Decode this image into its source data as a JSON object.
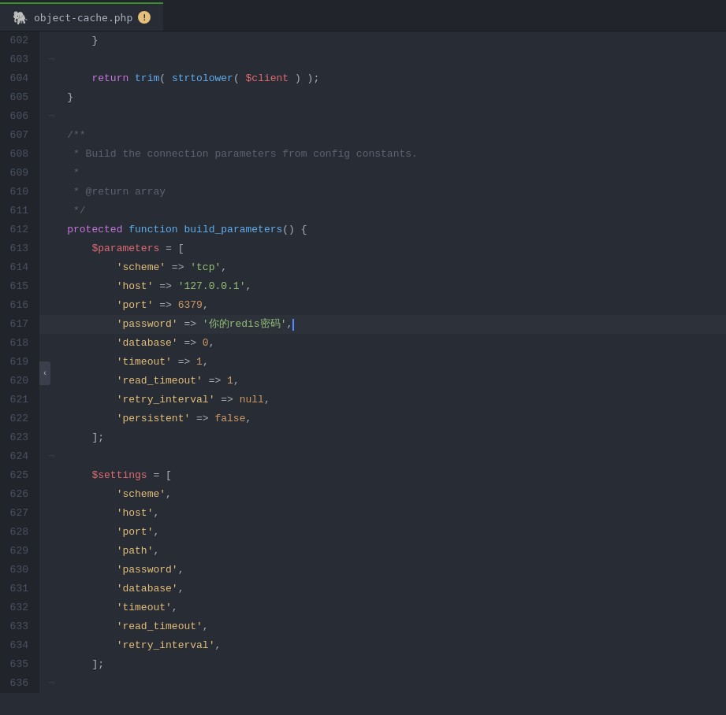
{
  "tab": {
    "icon": "🐘",
    "filename": "object-cache.php",
    "warning": "!",
    "underline_color": "#3a8f2a"
  },
  "colors": {
    "bg": "#282c34",
    "line_num_bg": "#21252b",
    "line_num_text": "#4b5263",
    "active_line": "#2c313a",
    "text_default": "#abb2bf",
    "keyword_purple": "#c678dd",
    "keyword_blue": "#61afef",
    "string_green": "#98c379",
    "number_orange": "#d19a66",
    "var_red": "#e06c75",
    "key_yellow": "#e5c07b",
    "comment_gray": "#5c6370"
  },
  "lines": [
    {
      "num": "602",
      "tokens": [
        {
          "t": "        }",
          "c": "punct"
        }
      ]
    },
    {
      "num": "603",
      "tokens": []
    },
    {
      "num": "604",
      "tokens": [
        {
          "t": "        ",
          "c": ""
        },
        {
          "t": "return",
          "c": "kw"
        },
        {
          "t": " ",
          "c": ""
        },
        {
          "t": "trim",
          "c": "fn"
        },
        {
          "t": "(",
          "c": "punct"
        },
        {
          "t": " strtolower",
          "c": "fn"
        },
        {
          "t": "(",
          "c": "punct"
        },
        {
          "t": " ",
          "c": ""
        },
        {
          "t": "$client",
          "c": "var"
        },
        {
          "t": " ",
          "c": ""
        },
        {
          "t": ")",
          "c": "punct"
        },
        {
          "t": " ",
          "c": ""
        },
        {
          "t": ");",
          "c": "punct"
        }
      ]
    },
    {
      "num": "605",
      "tokens": [
        {
          "t": "    }",
          "c": "punct"
        }
      ]
    },
    {
      "num": "606",
      "tokens": []
    },
    {
      "num": "607",
      "tokens": [
        {
          "t": "    ",
          "c": ""
        },
        {
          "t": "/**",
          "c": "comment"
        }
      ]
    },
    {
      "num": "608",
      "tokens": [
        {
          "t": "     * Build the connection parameters from config constants.",
          "c": "comment"
        }
      ]
    },
    {
      "num": "609",
      "tokens": [
        {
          "t": "     *",
          "c": "comment"
        }
      ]
    },
    {
      "num": "610",
      "tokens": [
        {
          "t": "     * @return array",
          "c": "comment"
        }
      ]
    },
    {
      "num": "611",
      "tokens": [
        {
          "t": "     */",
          "c": "comment"
        }
      ]
    },
    {
      "num": "612",
      "tokens": [
        {
          "t": "    ",
          "c": ""
        },
        {
          "t": "protected",
          "c": "kw-purple"
        },
        {
          "t": " ",
          "c": ""
        },
        {
          "t": "function",
          "c": "kw-blue"
        },
        {
          "t": " ",
          "c": ""
        },
        {
          "t": "build_parameters",
          "c": "fn"
        },
        {
          "t": "() {",
          "c": "punct"
        }
      ]
    },
    {
      "num": "613",
      "tokens": [
        {
          "t": "        ",
          "c": ""
        },
        {
          "t": "$parameters",
          "c": "var"
        },
        {
          "t": " = [",
          "c": "punct"
        }
      ]
    },
    {
      "num": "614",
      "tokens": [
        {
          "t": "            ",
          "c": ""
        },
        {
          "t": "'scheme'",
          "c": "key"
        },
        {
          "t": " => ",
          "c": "op"
        },
        {
          "t": "'tcp'",
          "c": "str"
        },
        {
          "t": ",",
          "c": "punct"
        }
      ]
    },
    {
      "num": "615",
      "tokens": [
        {
          "t": "            ",
          "c": ""
        },
        {
          "t": "'host'",
          "c": "key"
        },
        {
          "t": " => ",
          "c": "op"
        },
        {
          "t": "'127.0.0.1'",
          "c": "str"
        },
        {
          "t": ",",
          "c": "punct"
        }
      ]
    },
    {
      "num": "616",
      "tokens": [
        {
          "t": "            ",
          "c": ""
        },
        {
          "t": "'port'",
          "c": "key"
        },
        {
          "t": " => ",
          "c": "op"
        },
        {
          "t": "6379",
          "c": "num"
        },
        {
          "t": ",",
          "c": "punct"
        }
      ]
    },
    {
      "num": "617",
      "tokens": [
        {
          "t": "            ",
          "c": ""
        },
        {
          "t": "'password'",
          "c": "key"
        },
        {
          "t": " => ",
          "c": "op"
        },
        {
          "t": "'你的redis密码'",
          "c": "str"
        },
        {
          "t": ",",
          "c": "punct"
        },
        {
          "t": "|",
          "c": "cursor"
        }
      ],
      "highlight": true
    },
    {
      "num": "618",
      "tokens": [
        {
          "t": "            ",
          "c": ""
        },
        {
          "t": "'database'",
          "c": "key"
        },
        {
          "t": " => ",
          "c": "op"
        },
        {
          "t": "0",
          "c": "num"
        },
        {
          "t": ",",
          "c": "punct"
        }
      ]
    },
    {
      "num": "619",
      "tokens": [
        {
          "t": "            ",
          "c": ""
        },
        {
          "t": "'timeout'",
          "c": "key"
        },
        {
          "t": " => ",
          "c": "op"
        },
        {
          "t": "1",
          "c": "num"
        },
        {
          "t": ",",
          "c": "punct"
        }
      ]
    },
    {
      "num": "620",
      "tokens": [
        {
          "t": "            ",
          "c": ""
        },
        {
          "t": "'read_timeout'",
          "c": "key"
        },
        {
          "t": " => ",
          "c": "op"
        },
        {
          "t": "1",
          "c": "num"
        },
        {
          "t": ",",
          "c": "punct"
        }
      ]
    },
    {
      "num": "621",
      "tokens": [
        {
          "t": "            ",
          "c": ""
        },
        {
          "t": "'retry_interval'",
          "c": "key"
        },
        {
          "t": " => ",
          "c": "op"
        },
        {
          "t": "null",
          "c": "kw-null"
        },
        {
          "t": ",",
          "c": "punct"
        }
      ]
    },
    {
      "num": "622",
      "tokens": [
        {
          "t": "            ",
          "c": ""
        },
        {
          "t": "'persistent'",
          "c": "key"
        },
        {
          "t": " => ",
          "c": "op"
        },
        {
          "t": "false",
          "c": "kw-null"
        },
        {
          "t": ",",
          "c": "punct"
        }
      ]
    },
    {
      "num": "623",
      "tokens": [
        {
          "t": "        ];",
          "c": "punct"
        }
      ]
    },
    {
      "num": "624",
      "tokens": []
    },
    {
      "num": "625",
      "tokens": [
        {
          "t": "        ",
          "c": ""
        },
        {
          "t": "$settings",
          "c": "var"
        },
        {
          "t": " = [",
          "c": "punct"
        }
      ]
    },
    {
      "num": "626",
      "tokens": [
        {
          "t": "            ",
          "c": ""
        },
        {
          "t": "'scheme'",
          "c": "key"
        },
        {
          "t": ",",
          "c": "punct"
        }
      ]
    },
    {
      "num": "627",
      "tokens": [
        {
          "t": "            ",
          "c": ""
        },
        {
          "t": "'host'",
          "c": "key"
        },
        {
          "t": ",",
          "c": "punct"
        }
      ]
    },
    {
      "num": "628",
      "tokens": [
        {
          "t": "            ",
          "c": ""
        },
        {
          "t": "'port'",
          "c": "key"
        },
        {
          "t": ",",
          "c": "punct"
        }
      ]
    },
    {
      "num": "629",
      "tokens": [
        {
          "t": "            ",
          "c": ""
        },
        {
          "t": "'path'",
          "c": "key"
        },
        {
          "t": ",",
          "c": "punct"
        }
      ]
    },
    {
      "num": "630",
      "tokens": [
        {
          "t": "            ",
          "c": ""
        },
        {
          "t": "'password'",
          "c": "key"
        },
        {
          "t": ",",
          "c": "punct"
        }
      ]
    },
    {
      "num": "631",
      "tokens": [
        {
          "t": "            ",
          "c": ""
        },
        {
          "t": "'database'",
          "c": "key"
        },
        {
          "t": ",",
          "c": "punct"
        }
      ]
    },
    {
      "num": "632",
      "tokens": [
        {
          "t": "            ",
          "c": ""
        },
        {
          "t": "'timeout'",
          "c": "key"
        },
        {
          "t": ",",
          "c": "punct"
        }
      ]
    },
    {
      "num": "633",
      "tokens": [
        {
          "t": "            ",
          "c": ""
        },
        {
          "t": "'read_timeout'",
          "c": "key"
        },
        {
          "t": ",",
          "c": "punct"
        }
      ]
    },
    {
      "num": "634",
      "tokens": [
        {
          "t": "            ",
          "c": ""
        },
        {
          "t": "'retry_interval'",
          "c": "key"
        },
        {
          "t": ",",
          "c": "punct"
        }
      ]
    },
    {
      "num": "635",
      "tokens": [
        {
          "t": "        ];",
          "c": "punct"
        }
      ]
    },
    {
      "num": "636",
      "tokens": []
    }
  ]
}
